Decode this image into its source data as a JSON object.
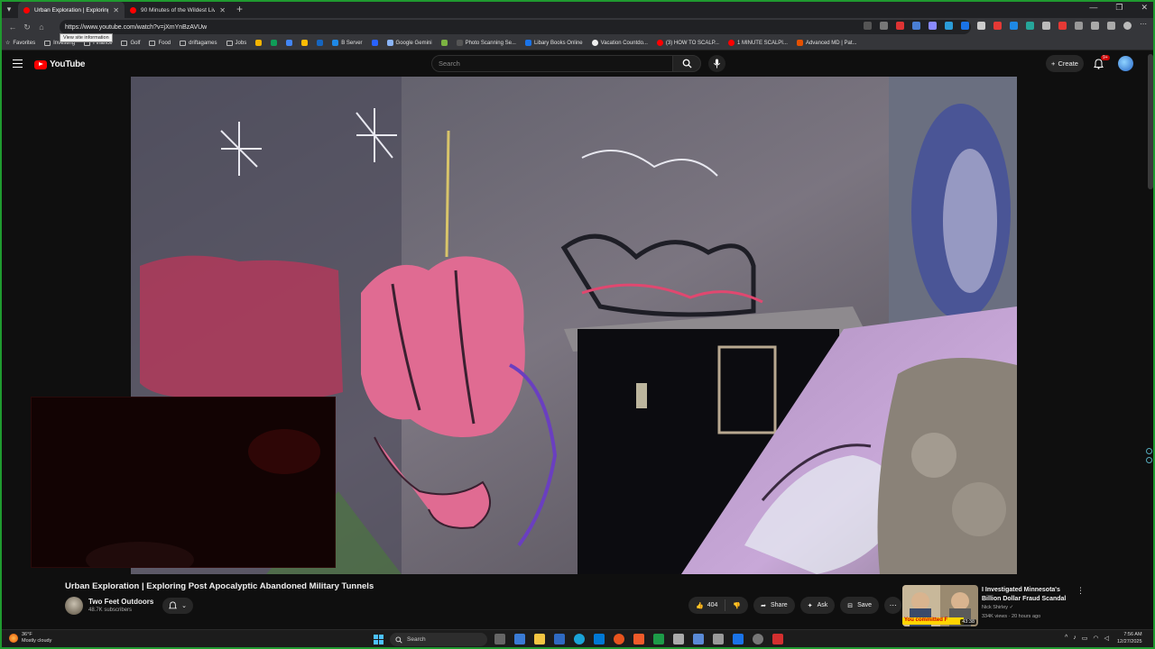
{
  "browser": {
    "tabs": [
      {
        "label": "Urban Exploration | Exploring Post",
        "active": true
      },
      {
        "label": "90 Minutes of the Wildest Live Te",
        "active": false
      }
    ],
    "url": "https://www.youtube.com/watch?v=jXmYnBzAVUw",
    "tooltip": "View site information",
    "bookmarks": [
      {
        "label": "Favorites",
        "icon": "star-icon"
      },
      {
        "label": "Investing",
        "icon": "folder-icon"
      },
      {
        "label": "Finance",
        "icon": "folder-icon"
      },
      {
        "label": "Golf",
        "icon": "folder-icon"
      },
      {
        "label": "Food",
        "icon": "folder-icon"
      },
      {
        "label": "driftagames",
        "icon": "folder-icon"
      },
      {
        "label": "Jobs",
        "icon": "folder-icon"
      },
      {
        "label": "B Server",
        "icon": "site-icon"
      },
      {
        "label": "Google Gemini",
        "icon": "site-icon"
      },
      {
        "label": "Photo Scanning Se...",
        "icon": "site-icon"
      },
      {
        "label": "Libary Books Online",
        "icon": "site-icon"
      },
      {
        "label": "Vacation Countdo...",
        "icon": "site-icon"
      },
      {
        "label": "(3) HOW TO SCALP...",
        "icon": "youtube-icon"
      },
      {
        "label": "1 MINUTE SCALPI...",
        "icon": "youtube-icon"
      },
      {
        "label": "Advanced MD | Pat...",
        "icon": "site-icon"
      }
    ]
  },
  "youtube": {
    "logo": "YouTube",
    "search_placeholder": "Search",
    "create_label": "Create",
    "notification_count": "9+"
  },
  "video": {
    "title": "Urban Exploration | Exploring Post Apocalyptic Abandoned Military Tunnels",
    "channel": "Two Feet Outdoors",
    "subscribers": "48.7K subscribers",
    "likes": "404",
    "share_label": "Share",
    "ask_label": "Ask",
    "save_label": "Save"
  },
  "recommendation": {
    "title": "I Investigated Minnesota's Billion Dollar Fraud Scandal",
    "channel": "Nick Shirley",
    "meta": "334K views · 20 hours ago",
    "duration": "43:38",
    "thumb_caption": "You committed F"
  },
  "taskbar": {
    "temp": "36°F",
    "weather": "Mostly cloudy",
    "search_label": "Search",
    "time": "7:56 AM",
    "date": "12/27/2025"
  },
  "colors": {
    "youtube_red": "#ff0000",
    "background": "#0f0f0f",
    "frame_border": "#1f9a2f"
  }
}
